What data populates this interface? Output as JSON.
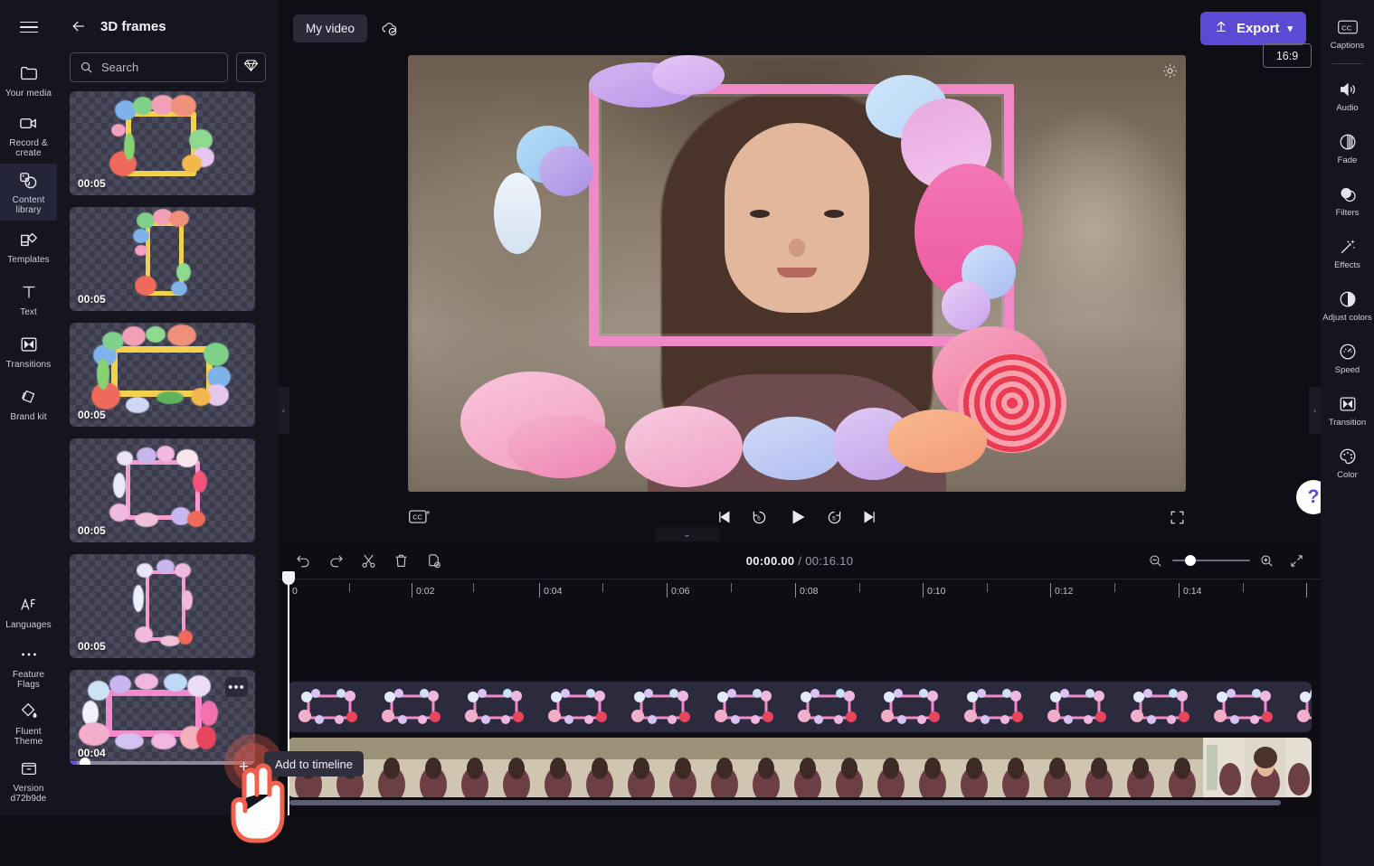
{
  "app": {
    "name": "clipchamp-video-editor"
  },
  "left_rail": {
    "menu_icon": "hamburger-icon",
    "items": [
      {
        "label": "Your media",
        "icon": "folder-icon",
        "active": false
      },
      {
        "label": "Record & create",
        "icon": "video-camera-icon",
        "active": false
      },
      {
        "label": "Content library",
        "icon": "content-library-icon",
        "active": true
      },
      {
        "label": "Templates",
        "icon": "templates-icon",
        "active": false
      },
      {
        "label": "Text",
        "icon": "text-icon",
        "active": false
      },
      {
        "label": "Transitions",
        "icon": "transitions-icon",
        "active": false
      },
      {
        "label": "Brand kit",
        "icon": "brand-kit-icon",
        "active": false
      }
    ],
    "bottom_items": [
      {
        "label": "Languages",
        "icon": "languages-icon"
      },
      {
        "label": "Feature Flags",
        "icon": "ellipsis-icon"
      },
      {
        "label": "Fluent Theme",
        "icon": "paint-bucket-icon"
      },
      {
        "label": "Version d72b9de",
        "icon": "box-icon"
      }
    ]
  },
  "content_panel": {
    "title": "3D frames",
    "back_icon": "back-arrow-icon",
    "search": {
      "placeholder": "Search",
      "value": "",
      "icon": "search-icon"
    },
    "premium_button_icon": "diamond-icon",
    "items": [
      {
        "duration": "00:05",
        "orientation": "landscape",
        "style": "flower-yellow"
      },
      {
        "duration": "00:05",
        "orientation": "portrait",
        "style": "flower-yellow"
      },
      {
        "duration": "00:05",
        "orientation": "landscape",
        "style": "flower-yellow-wide"
      },
      {
        "duration": "00:05",
        "orientation": "landscape",
        "style": "pastel-pink"
      },
      {
        "duration": "00:05",
        "orientation": "portrait",
        "style": "pastel-pink"
      },
      {
        "duration": "00:04",
        "orientation": "landscape",
        "style": "pastel-pink-selected",
        "selected": true,
        "more_icon": "more-options-icon"
      }
    ]
  },
  "top_bar": {
    "project_name": "My video",
    "save_status_icon": "cloud-saved-icon",
    "export": {
      "label": "Export",
      "icon": "upload-icon",
      "chevron": "chevron-down-icon",
      "color": "#5b4ad4"
    }
  },
  "preview": {
    "settings_icon": "gear-icon",
    "aspect_ratio": "16:9",
    "overlay_name": "3d-frame-overlay"
  },
  "player_controls": {
    "captions_icon": "closed-captions-icon",
    "buttons": [
      {
        "name": "skip-to-start",
        "icon": "skip-start-icon"
      },
      {
        "name": "rewind-5",
        "icon": "rewind-5-icon",
        "label": "5"
      },
      {
        "name": "play",
        "icon": "play-icon"
      },
      {
        "name": "forward-5",
        "icon": "forward-5-icon",
        "label": "5"
      },
      {
        "name": "skip-to-end",
        "icon": "skip-end-icon"
      }
    ],
    "fullscreen_icon": "fullscreen-icon"
  },
  "help": {
    "label": "?"
  },
  "right_rail": {
    "items": [
      {
        "label": "Captions",
        "icon": "cc-icon"
      },
      {
        "label": "Audio",
        "icon": "speaker-icon"
      },
      {
        "label": "Fade",
        "icon": "fade-icon"
      },
      {
        "label": "Filters",
        "icon": "filters-icon"
      },
      {
        "label": "Effects",
        "icon": "magic-wand-icon"
      },
      {
        "label": "Adjust colors",
        "icon": "contrast-icon"
      },
      {
        "label": "Speed",
        "icon": "speedometer-icon"
      },
      {
        "label": "Transition",
        "icon": "transition-icon"
      },
      {
        "label": "Color",
        "icon": "palette-icon"
      }
    ]
  },
  "timeline": {
    "tools": [
      {
        "name": "undo",
        "icon": "undo-icon"
      },
      {
        "name": "redo",
        "icon": "redo-icon"
      },
      {
        "name": "split",
        "icon": "scissors-icon"
      },
      {
        "name": "delete",
        "icon": "trash-icon"
      },
      {
        "name": "duplicate",
        "icon": "duplicate-icon"
      }
    ],
    "current_time": "00:00.00",
    "total_time": "00:16.10",
    "time_separator": "/",
    "zoom_out_icon": "zoom-out-icon",
    "zoom_in_icon": "zoom-in-icon",
    "fit_icon": "fit-to-screen-icon",
    "zoom_value": 18,
    "ruler_labels": [
      "0",
      "0:02",
      "0:04",
      "0:06",
      "0:08",
      "0:10",
      "0:12",
      "0:14"
    ],
    "playhead_position": "0",
    "tracks": [
      {
        "name": "overlay-track",
        "type": "frames",
        "clip_count": 13
      },
      {
        "name": "video-track",
        "type": "video",
        "clip_count": 25
      }
    ]
  },
  "tooltip": {
    "text": "Add to timeline"
  },
  "cursor": {
    "icon": "hand-pointer-icon",
    "action": "click"
  },
  "colors": {
    "accent": "#5b4ad4",
    "panel_bg": "#15151f",
    "app_bg": "#0e0e14",
    "timeline_bg": "#0d0d13",
    "track_bg": "#2b2b3d",
    "cursor_red": "#eb5a46"
  }
}
